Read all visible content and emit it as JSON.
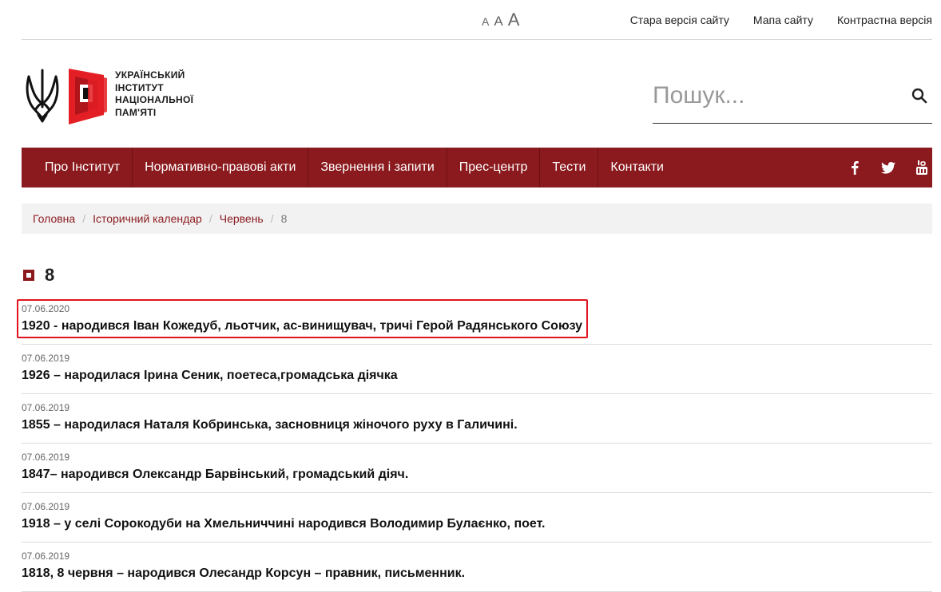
{
  "font_sizes": [
    "A",
    "A",
    "A"
  ],
  "top_links": [
    "Стара версія сайту",
    "Мапа сайту",
    "Контрастна версія"
  ],
  "logo": {
    "lines": [
      "УКРАЇНСЬКИЙ",
      "ІНСТИТУТ",
      "НАЦІОНАЛЬНОЇ",
      "ПАМ'ЯТІ"
    ]
  },
  "search": {
    "placeholder": "Пошук..."
  },
  "nav": {
    "items": [
      "Про Інститут",
      "Нормативно-правові акти",
      "Звернення і запити",
      "Прес-центр",
      "Тести",
      "Контакти"
    ]
  },
  "breadcrumb": {
    "items": [
      "Головна",
      "Історичний календар",
      "Червень"
    ],
    "current": "8",
    "separator": "/"
  },
  "page_title": "8",
  "articles": [
    {
      "date": "07.06.2020",
      "title": "1920 - народився Іван Кожедуб, льотчик, ас-винищувач, тричі Герой Радянського Союзу"
    },
    {
      "date": "07.06.2019",
      "title": "1926 – народилася Ірина Сеник, поетеса,громадська діячка"
    },
    {
      "date": "07.06.2019",
      "title": "1855 – народилася Наталя Кобринська, засновниця жіночого руху в Галичині."
    },
    {
      "date": "07.06.2019",
      "title": "1847– народився Олександр Барвінський, громадський діяч."
    },
    {
      "date": "07.06.2019",
      "title": "1918 – у селі Сорокодуби на Хмельниччині народився Володимир Булаєнко, поет."
    },
    {
      "date": "07.06.2019",
      "title": "1818, 8 червня – народився Олесандр Корсун – правник, письменник."
    }
  ],
  "colors": {
    "brand": "#8b1a1e",
    "highlight": "#e0141e",
    "logo_red": "#e31e24"
  },
  "icons": [
    "trident-icon",
    "logo-mark-icon",
    "search-icon",
    "facebook-icon",
    "twitter-icon",
    "youtube-icon"
  ]
}
